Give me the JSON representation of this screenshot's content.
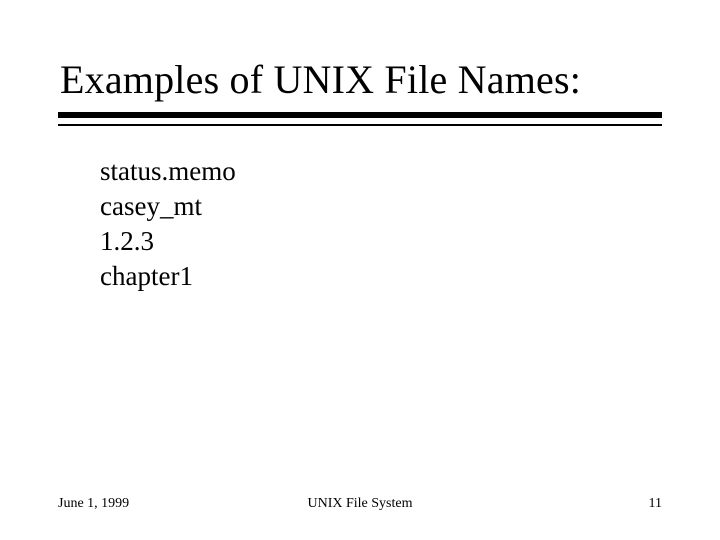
{
  "title": "Examples of UNIX File Names:",
  "items": {
    "0": "status.memo",
    "1": "casey_mt",
    "2": "1.2.3",
    "3": "chapter1"
  },
  "footer": {
    "date": "June 1, 1999",
    "center": "UNIX File System",
    "page": "11"
  }
}
